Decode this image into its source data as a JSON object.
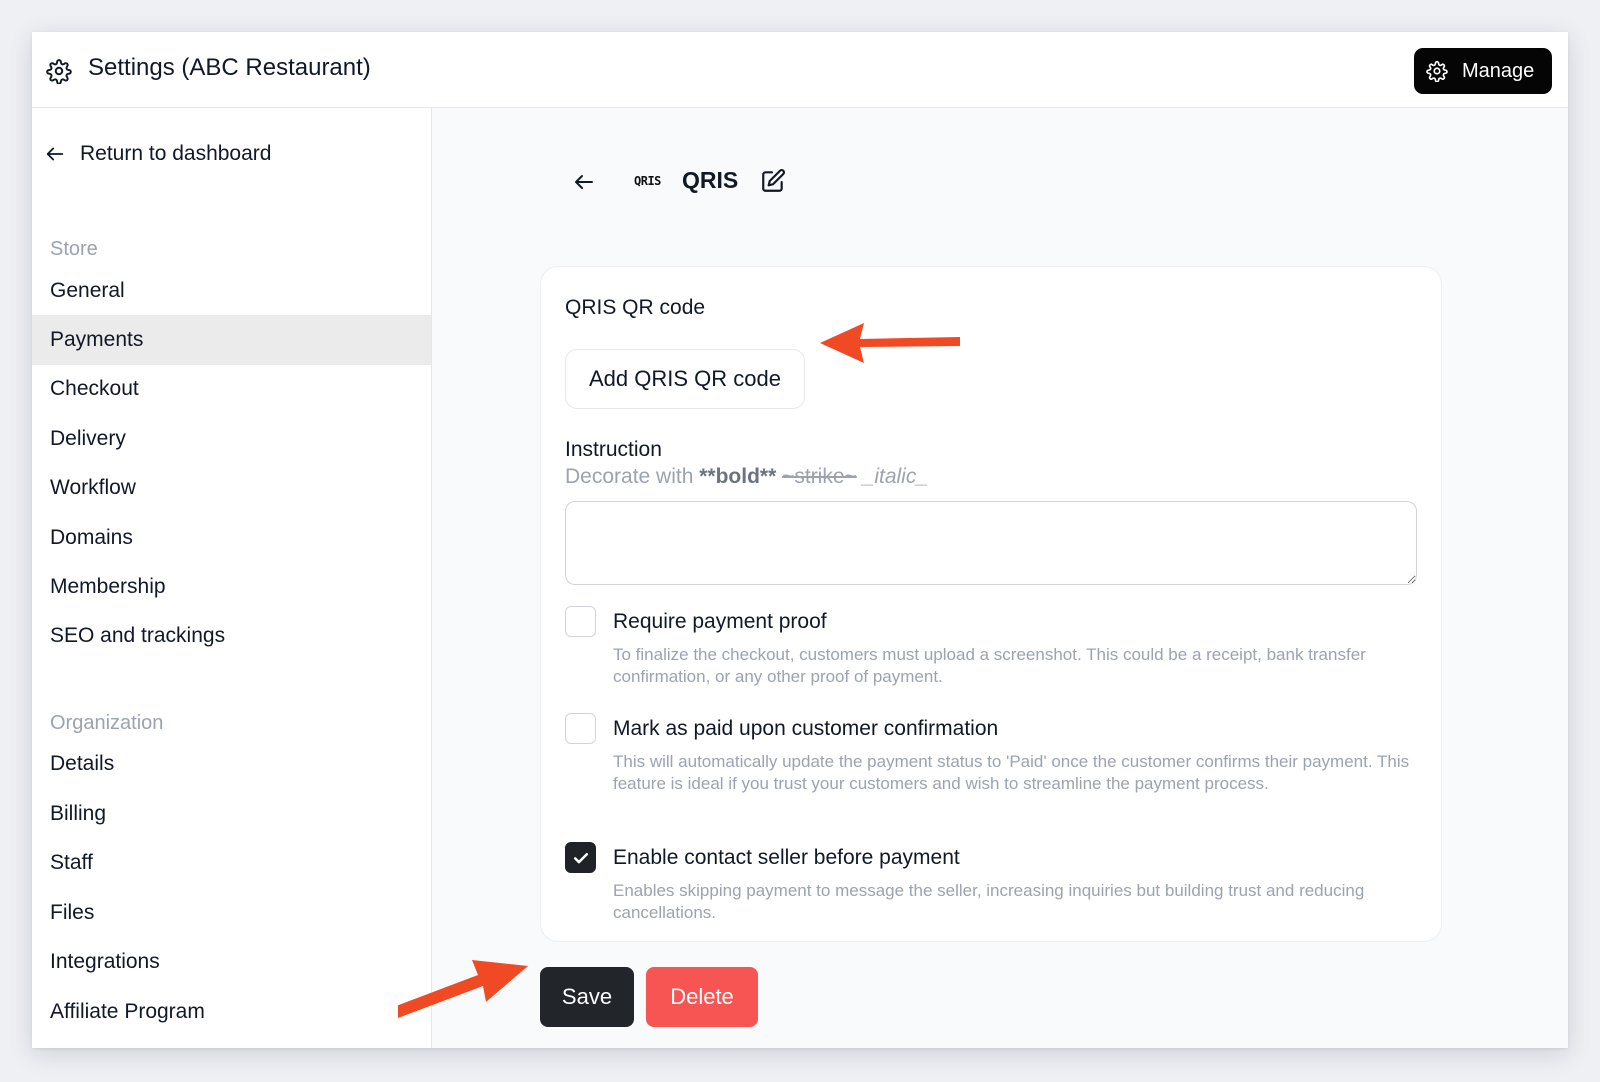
{
  "header": {
    "title": "Settings (ABC Restaurant)",
    "manage_label": "Manage"
  },
  "sidebar": {
    "return_label": "Return to dashboard",
    "store_label": "Store",
    "store_items": [
      "General",
      "Payments",
      "Checkout",
      "Delivery",
      "Workflow",
      "Domains",
      "Membership",
      "SEO and trackings"
    ],
    "active_item": "Payments",
    "organization_label": "Organization",
    "organization_items": [
      "Details",
      "Billing",
      "Staff",
      "Files",
      "Integrations",
      "Affiliate Program"
    ]
  },
  "main": {
    "logo_text": "QRIS",
    "page_title": "QRIS",
    "qr_section_label": "QRIS QR code",
    "add_qr_label": "Add QRIS QR code",
    "instruction_label": "Instruction",
    "hint": {
      "prefix": "Decorate with ",
      "bold": "**bold**",
      "strike": "~strike~",
      "italic": "_italic_"
    },
    "instruction_value": "",
    "options": [
      {
        "title": "Require payment proof",
        "description": "To finalize the checkout, customers must upload a screenshot. This could be a receipt, bank transfer confirmation, or any other proof of payment.",
        "checked": false
      },
      {
        "title": "Mark as paid upon customer confirmation",
        "description": "This will automatically update the payment status to 'Paid' once the customer confirms their payment. This feature is ideal if you trust your customers and wish to streamline the payment process.",
        "checked": false
      },
      {
        "title": "Enable contact seller before payment",
        "description": "Enables skipping payment to message the seller, increasing inquiries but building trust and reducing cancellations.",
        "checked": true
      }
    ],
    "save_label": "Save",
    "delete_label": "Delete"
  },
  "colors": {
    "annotation_arrow": "#f04a24",
    "delete": "#f75454",
    "save": "#22262b",
    "active_nav": "#ebebeb"
  },
  "icons": [
    "gear-icon",
    "arrow-left-icon",
    "edit-icon",
    "check-icon",
    "annotation-arrow"
  ]
}
